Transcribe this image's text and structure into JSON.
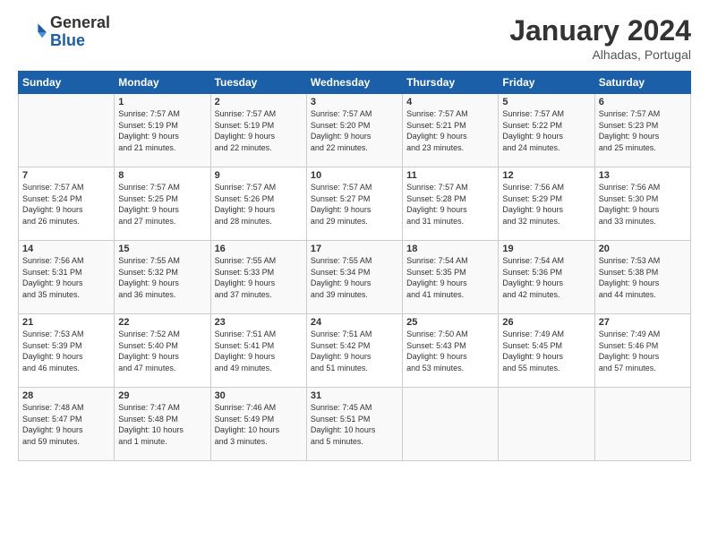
{
  "header": {
    "logo_text_general": "General",
    "logo_text_blue": "Blue",
    "month_title": "January 2024",
    "location": "Alhadas, Portugal"
  },
  "days_of_week": [
    "Sunday",
    "Monday",
    "Tuesday",
    "Wednesday",
    "Thursday",
    "Friday",
    "Saturday"
  ],
  "weeks": [
    [
      {
        "day": "",
        "info": ""
      },
      {
        "day": "1",
        "info": "Sunrise: 7:57 AM\nSunset: 5:19 PM\nDaylight: 9 hours\nand 21 minutes."
      },
      {
        "day": "2",
        "info": "Sunrise: 7:57 AM\nSunset: 5:19 PM\nDaylight: 9 hours\nand 22 minutes."
      },
      {
        "day": "3",
        "info": "Sunrise: 7:57 AM\nSunset: 5:20 PM\nDaylight: 9 hours\nand 22 minutes."
      },
      {
        "day": "4",
        "info": "Sunrise: 7:57 AM\nSunset: 5:21 PM\nDaylight: 9 hours\nand 23 minutes."
      },
      {
        "day": "5",
        "info": "Sunrise: 7:57 AM\nSunset: 5:22 PM\nDaylight: 9 hours\nand 24 minutes."
      },
      {
        "day": "6",
        "info": "Sunrise: 7:57 AM\nSunset: 5:23 PM\nDaylight: 9 hours\nand 25 minutes."
      }
    ],
    [
      {
        "day": "7",
        "info": "Sunrise: 7:57 AM\nSunset: 5:24 PM\nDaylight: 9 hours\nand 26 minutes."
      },
      {
        "day": "8",
        "info": "Sunrise: 7:57 AM\nSunset: 5:25 PM\nDaylight: 9 hours\nand 27 minutes."
      },
      {
        "day": "9",
        "info": "Sunrise: 7:57 AM\nSunset: 5:26 PM\nDaylight: 9 hours\nand 28 minutes."
      },
      {
        "day": "10",
        "info": "Sunrise: 7:57 AM\nSunset: 5:27 PM\nDaylight: 9 hours\nand 29 minutes."
      },
      {
        "day": "11",
        "info": "Sunrise: 7:57 AM\nSunset: 5:28 PM\nDaylight: 9 hours\nand 31 minutes."
      },
      {
        "day": "12",
        "info": "Sunrise: 7:56 AM\nSunset: 5:29 PM\nDaylight: 9 hours\nand 32 minutes."
      },
      {
        "day": "13",
        "info": "Sunrise: 7:56 AM\nSunset: 5:30 PM\nDaylight: 9 hours\nand 33 minutes."
      }
    ],
    [
      {
        "day": "14",
        "info": "Sunrise: 7:56 AM\nSunset: 5:31 PM\nDaylight: 9 hours\nand 35 minutes."
      },
      {
        "day": "15",
        "info": "Sunrise: 7:55 AM\nSunset: 5:32 PM\nDaylight: 9 hours\nand 36 minutes."
      },
      {
        "day": "16",
        "info": "Sunrise: 7:55 AM\nSunset: 5:33 PM\nDaylight: 9 hours\nand 37 minutes."
      },
      {
        "day": "17",
        "info": "Sunrise: 7:55 AM\nSunset: 5:34 PM\nDaylight: 9 hours\nand 39 minutes."
      },
      {
        "day": "18",
        "info": "Sunrise: 7:54 AM\nSunset: 5:35 PM\nDaylight: 9 hours\nand 41 minutes."
      },
      {
        "day": "19",
        "info": "Sunrise: 7:54 AM\nSunset: 5:36 PM\nDaylight: 9 hours\nand 42 minutes."
      },
      {
        "day": "20",
        "info": "Sunrise: 7:53 AM\nSunset: 5:38 PM\nDaylight: 9 hours\nand 44 minutes."
      }
    ],
    [
      {
        "day": "21",
        "info": "Sunrise: 7:53 AM\nSunset: 5:39 PM\nDaylight: 9 hours\nand 46 minutes."
      },
      {
        "day": "22",
        "info": "Sunrise: 7:52 AM\nSunset: 5:40 PM\nDaylight: 9 hours\nand 47 minutes."
      },
      {
        "day": "23",
        "info": "Sunrise: 7:51 AM\nSunset: 5:41 PM\nDaylight: 9 hours\nand 49 minutes."
      },
      {
        "day": "24",
        "info": "Sunrise: 7:51 AM\nSunset: 5:42 PM\nDaylight: 9 hours\nand 51 minutes."
      },
      {
        "day": "25",
        "info": "Sunrise: 7:50 AM\nSunset: 5:43 PM\nDaylight: 9 hours\nand 53 minutes."
      },
      {
        "day": "26",
        "info": "Sunrise: 7:49 AM\nSunset: 5:45 PM\nDaylight: 9 hours\nand 55 minutes."
      },
      {
        "day": "27",
        "info": "Sunrise: 7:49 AM\nSunset: 5:46 PM\nDaylight: 9 hours\nand 57 minutes."
      }
    ],
    [
      {
        "day": "28",
        "info": "Sunrise: 7:48 AM\nSunset: 5:47 PM\nDaylight: 9 hours\nand 59 minutes."
      },
      {
        "day": "29",
        "info": "Sunrise: 7:47 AM\nSunset: 5:48 PM\nDaylight: 10 hours\nand 1 minute."
      },
      {
        "day": "30",
        "info": "Sunrise: 7:46 AM\nSunset: 5:49 PM\nDaylight: 10 hours\nand 3 minutes."
      },
      {
        "day": "31",
        "info": "Sunrise: 7:45 AM\nSunset: 5:51 PM\nDaylight: 10 hours\nand 5 minutes."
      },
      {
        "day": "",
        "info": ""
      },
      {
        "day": "",
        "info": ""
      },
      {
        "day": "",
        "info": ""
      }
    ]
  ]
}
